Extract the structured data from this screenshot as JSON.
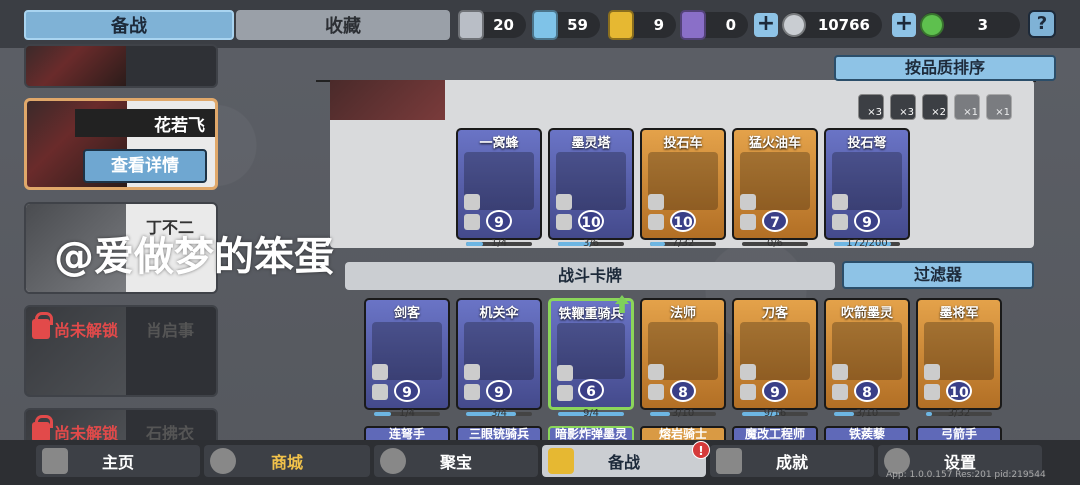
{
  "top_tabs": [
    "备战",
    "收藏"
  ],
  "resources": [
    {
      "icon": "silver-badge-icon",
      "value": "20",
      "color": "#b9bec6"
    },
    {
      "icon": "crystal-badge-icon",
      "value": "59",
      "color": "#7fc3e8"
    },
    {
      "icon": "gold-badge-icon",
      "value": "9",
      "color": "#e6b832"
    },
    {
      "icon": "purple-badge-icon",
      "value": "0",
      "color": "#8a6fc8"
    }
  ],
  "coins": "10766",
  "gems": "3",
  "help_label": "?",
  "heroes": [
    {
      "name": "花若飞",
      "details_label": "查看详情",
      "selected": true
    },
    {
      "name": "丁不二",
      "locked": false
    },
    {
      "name": "肖启事",
      "lock_label": "尚未解锁",
      "locked": true
    },
    {
      "name": "石拂衣",
      "lock_label": "尚未解锁",
      "locked": true
    }
  ],
  "sort_label": "按品质排序",
  "multipliers": [
    "×3",
    "×3",
    "×2",
    "×1",
    "×1"
  ],
  "deck_cards": [
    {
      "name": "一窝蜂",
      "cost": "9",
      "count": "1/4",
      "fill": 0.25,
      "color": "purple"
    },
    {
      "name": "墨灵塔",
      "cost": "10",
      "count": "3/6",
      "fill": 0.5,
      "color": "purple"
    },
    {
      "name": "投石车",
      "cost": "10",
      "count": "7/32",
      "fill": 0.22,
      "color": "orange"
    },
    {
      "name": "猛火油车",
      "cost": "7",
      "count": "0/6",
      "fill": 0.0,
      "color": "orange"
    },
    {
      "name": "投石弩",
      "cost": "9",
      "count": "172/200",
      "fill": 0.86,
      "color": "purple"
    }
  ],
  "section_title": "战斗卡牌",
  "filter_label": "过滤器",
  "battle_cards": [
    {
      "name": "剑客",
      "cost": "9",
      "count": "1/4",
      "fill": 0.25,
      "color": "purple",
      "upgrade": false
    },
    {
      "name": "机关伞",
      "cost": "9",
      "count": "3/4",
      "fill": 0.75,
      "color": "purple",
      "upgrade": false
    },
    {
      "name": "铁鞭重骑兵",
      "cost": "6",
      "count": "9/4",
      "fill": 1.0,
      "color": "purple",
      "upgrade": true
    },
    {
      "name": "法师",
      "cost": "8",
      "count": "3/10",
      "fill": 0.3,
      "color": "orange",
      "upgrade": false
    },
    {
      "name": "刀客",
      "cost": "9",
      "count": "9/16",
      "fill": 0.56,
      "color": "orange",
      "upgrade": false
    },
    {
      "name": "吹箭墨灵",
      "cost": "8",
      "count": "3/10",
      "fill": 0.3,
      "color": "orange",
      "upgrade": false
    },
    {
      "name": "墨将军",
      "cost": "10",
      "count": "3/32",
      "fill": 0.09,
      "color": "orange",
      "upgrade": false
    }
  ],
  "row3_cards": [
    "连弩手",
    "三眼铳骑兵",
    "暗影炸弹墨灵",
    "熔岩骑士",
    "魔改工程师",
    "铁蒺藜",
    "弓箭手"
  ],
  "watermark": "@爱做梦的笨蛋",
  "nav": [
    {
      "label": "主页",
      "icon": "home-icon"
    },
    {
      "label": "商城",
      "icon": "coins-icon"
    },
    {
      "label": "聚宝",
      "icon": "treasure-icon"
    },
    {
      "label": "备战",
      "icon": "cards-icon",
      "badge": "!"
    },
    {
      "label": "成就",
      "icon": "achievement-icon"
    },
    {
      "label": "设置",
      "icon": "gear-icon"
    }
  ],
  "version_text": "App: 1.0.0.157 Res:201 pid:219544"
}
